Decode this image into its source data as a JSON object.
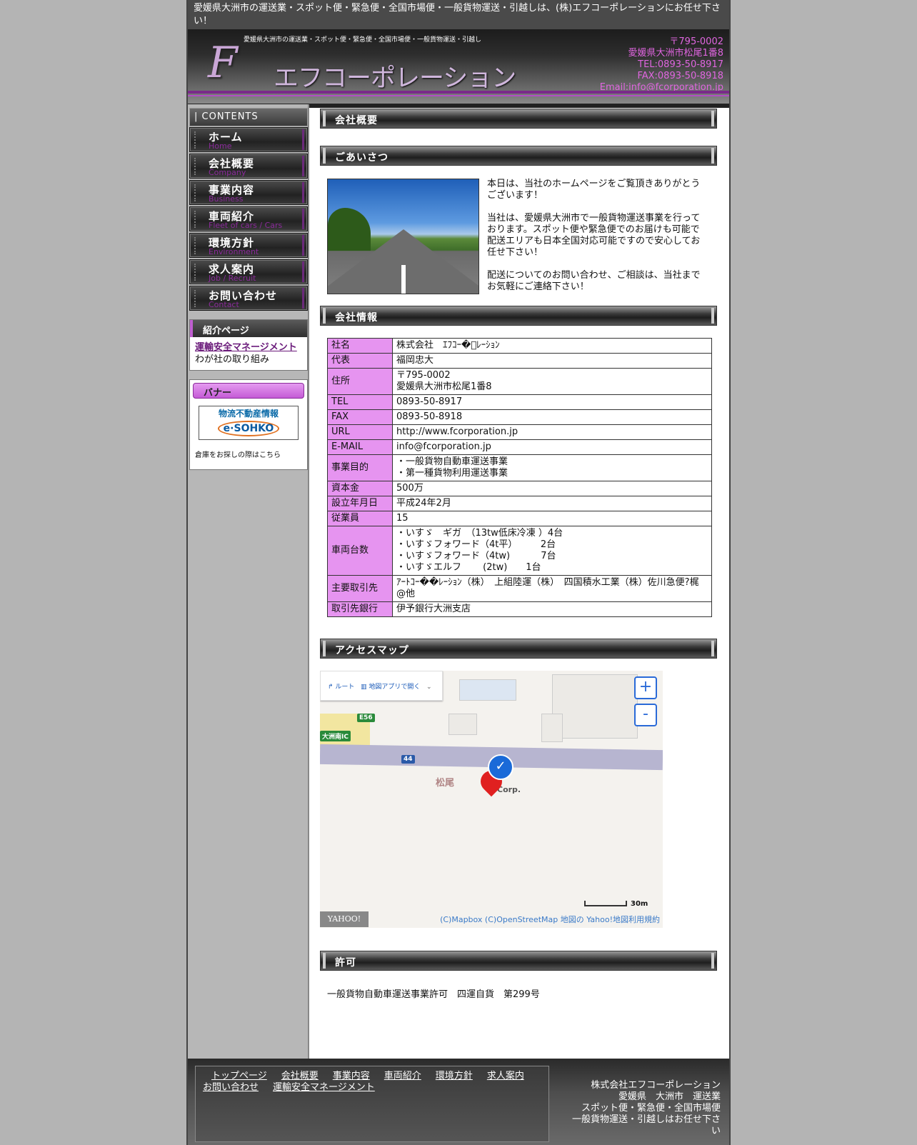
{
  "topbar": {
    "text": "愛媛県大洲市の運送業・スポット便・緊急便・全国市場便・一般貨物運送・引越しは、(株)エフコーポレーションにお任せ下さい！"
  },
  "header": {
    "tagline": "愛媛県大洲市の運送業・スポット便・緊急便・全国市場便・一般貨物運送・引越し",
    "logo_letter": "F",
    "logo_text": "エフコーポレーション",
    "contact": [
      "〒795-0002",
      "愛媛県大洲市松尾1番8",
      "TEL:0893-50-8917",
      "FAX:0893-50-8918",
      "Email:info@fcorporation.jp"
    ]
  },
  "sidebar": {
    "contents_label": "CONTENTS",
    "nav": [
      {
        "ja": "ホーム",
        "en": "Home"
      },
      {
        "ja": "会社概要",
        "en": "Company"
      },
      {
        "ja": "事業内容",
        "en": "Business"
      },
      {
        "ja": "車両紹介",
        "en": "Fleet of cars / Cars"
      },
      {
        "ja": "環境方針",
        "en": "Environment"
      },
      {
        "ja": "求人案内",
        "en": "Job / Recruit"
      },
      {
        "ja": "お問い合わせ",
        "en": "Contact"
      }
    ],
    "intro_title": "紹介ページ",
    "intro_link": "運輸安全マネージメント",
    "intro_text": "わが社の取り組み",
    "banner_title": "バナー",
    "banner_top": "物流不動産情報",
    "banner_logo": "e·SOHKO",
    "banner_note": "倉庫をお探しの際はこちら"
  },
  "main": {
    "page_title": "会社概要",
    "greeting_title": "ごあいさつ",
    "greeting": [
      "本日は、当社のホームページをご覧頂きありがとうございます！",
      "当社は、愛媛県大洲市で一般貨物運送事業を行っております。スポット便や緊急便でのお届けも可能で配送エリアも日本全国対応可能ですので安心してお任せ下さい！",
      "配送についてのお問い合わせ、ご相談は、当社までお気軽にご連絡下さい！"
    ],
    "info_title": "会社情報",
    "info": [
      {
        "k": "社名",
        "v": "株式会社　ｴﾌｺｰ�ﾟﾚｰｼｮﾝ"
      },
      {
        "k": "代表",
        "v": "福岡忠大"
      },
      {
        "k": "住所",
        "v": "〒795-0002\n愛媛県大洲市松尾1番8"
      },
      {
        "k": "TEL",
        "v": "0893-50-8917"
      },
      {
        "k": "FAX",
        "v": "0893-50-8918"
      },
      {
        "k": "URL",
        "v": "http://www.fcorporation.jp"
      },
      {
        "k": "E-MAIL",
        "v": "info@fcorporation.jp"
      },
      {
        "k": "事業目的",
        "v": "・一般貨物自動車運送事業\n・第一種貨物利用運送事業"
      },
      {
        "k": "資本金",
        "v": "500万"
      },
      {
        "k": "設立年月日",
        "v": "平成24年2月"
      },
      {
        "k": "従業員",
        "v": "15"
      },
      {
        "k": "車両台数",
        "v": "・いすゞ　ギガ　（13tw低床冷凍 ）4台\n・いすゞフォワード（4t平）　　　2台\n・いすゞフォワード（4tw)　　　 7台\n・いすゞエルフ　　 (2tw)　　1台"
      },
      {
        "k": "主要取引先",
        "v": "ｱｰﾄｺｰ��ﾚｰｼｮﾝ（株）　上組陸運（株）　四国積水工業（株）佐川急便?梶@他"
      },
      {
        "k": "取引先銀行",
        "v": "伊予銀行大洲支店"
      }
    ],
    "map_title": "アクセスマップ",
    "map": {
      "route_label": "ルート",
      "map_label": "地図アプリで開く",
      "zoom_in": "+",
      "zoom_out": "-",
      "place": "松尾",
      "corp": "Corp.",
      "ic_label": "大洲南IC",
      "road_e56": "E56",
      "road_44": "44",
      "scale": "30m",
      "yahoo": "YAHOO! JAPAN",
      "attribution": "(C)Mapbox  (C)OpenStreetMap  地図の  Yahoo!地図利用規約"
    },
    "permit_title": "許可",
    "permit_text": "一般貨物自動車運送事業許可　四運自貨　第299号"
  },
  "footer": {
    "links": [
      "トップページ",
      "会社概要",
      "事業内容",
      "車両紹介",
      "環境方針",
      "求人案内",
      "お問い合わせ",
      "運輸安全マネージメント"
    ],
    "address": [
      "株式会社エフコーポレーション",
      "愛媛県　大洲市　運送業",
      "スポット便・緊急便・全国市場便",
      "一般貨物運送・引越しはお任せ下さい"
    ]
  }
}
